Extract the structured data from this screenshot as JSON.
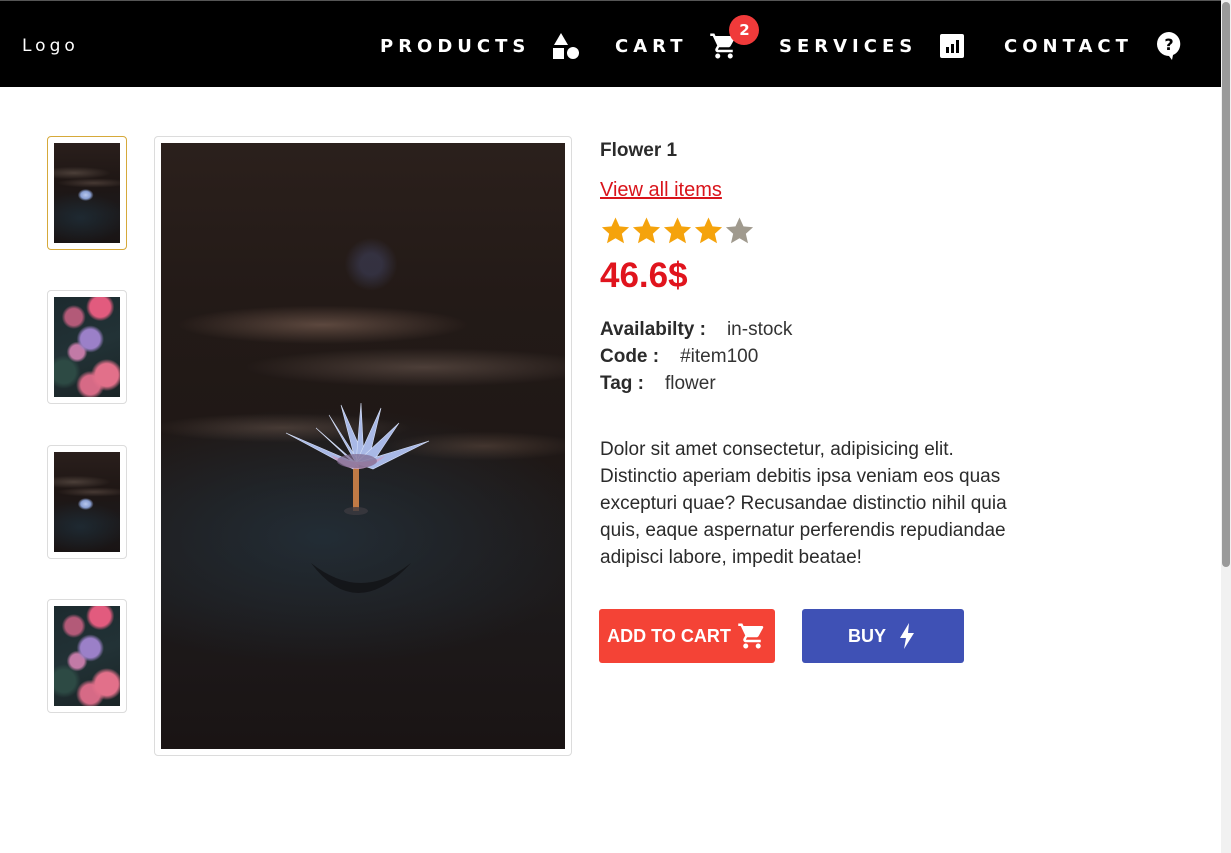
{
  "nav": {
    "logo": "Logo",
    "items": [
      {
        "label": "PRODUCTS",
        "icon": "shapes-icon"
      },
      {
        "label": "CART",
        "icon": "cart-icon",
        "badge": "2"
      },
      {
        "label": "SERVICES",
        "icon": "chart-icon"
      },
      {
        "label": "CONTACT",
        "icon": "help-icon"
      }
    ],
    "badge_color": "#f03a3a"
  },
  "product": {
    "title": "Flower 1",
    "view_all_link": "View all items",
    "rating": 4,
    "rating_max": 5,
    "price": "46.6$",
    "availability_key": "Availabilty :",
    "availability_value": "in-stock",
    "code_key": "Code :",
    "code_value": "#item100",
    "tag_key": "Tag :",
    "tag_value": "flower",
    "description": "Dolor sit amet consectetur, adipisicing elit. Distinctio aperiam debitis ipsa veniam eos quas excepturi quae? Recusandae distinctio nihil quia quis, eaque aspernatur perferendis repudiandae adipisci labore, impedit beatae!",
    "add_to_cart_label": "ADD TO CART",
    "buy_label": "BUY"
  },
  "colors": {
    "accent_red": "#f44336",
    "accent_blue": "#3f51b5",
    "price_red": "#e0141d",
    "star_filled": "#f5a30c",
    "star_empty": "#a09a8e",
    "active_thumb_border": "#d6a93a"
  }
}
